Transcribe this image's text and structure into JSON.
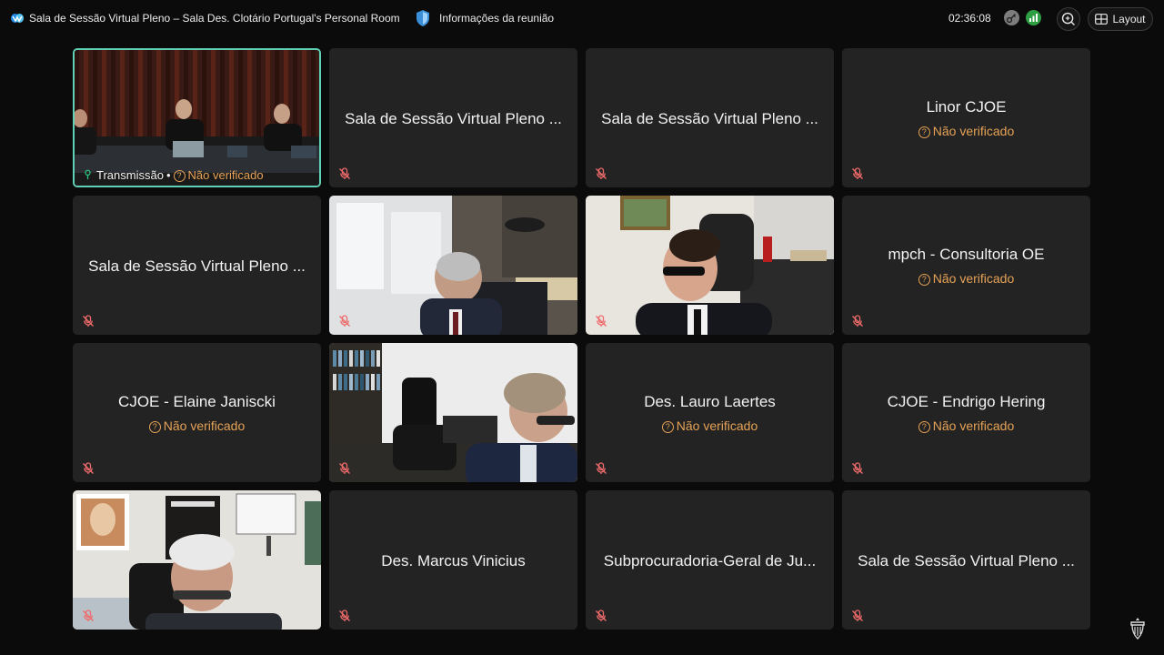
{
  "app": {
    "meeting_title": "Sala de Sessão Virtual Pleno – Sala Des. Clotário Portugal's Personal Room",
    "meeting_info_label": "Informações da reunião",
    "timer": "02:36:08",
    "layout_label": "Layout"
  },
  "tiles": [
    {
      "id": "t1",
      "kind": "video",
      "scene": "courtroom",
      "label": "Transmissão",
      "separator": "•",
      "status": "Não verificado"
    },
    {
      "id": "t2",
      "kind": "name",
      "name": "Sala de Sessão Virtual Pleno ..."
    },
    {
      "id": "t3",
      "kind": "name",
      "name": "Sala de Sessão Virtual Pleno ..."
    },
    {
      "id": "t4",
      "kind": "name",
      "name": "Linor CJOE",
      "status": "Não verificado"
    },
    {
      "id": "t5",
      "kind": "name",
      "name": "Sala de Sessão Virtual Pleno ..."
    },
    {
      "id": "t6",
      "kind": "video",
      "scene": "office-window"
    },
    {
      "id": "t7",
      "kind": "video",
      "scene": "office-glasses"
    },
    {
      "id": "t8",
      "kind": "name",
      "name": "mpch - Consultoria OE",
      "status": "Não verificado"
    },
    {
      "id": "t9",
      "kind": "name",
      "name": "CJOE - Elaine Janiscki",
      "status": "Não verificado"
    },
    {
      "id": "t10",
      "kind": "video",
      "scene": "office-bookshelf"
    },
    {
      "id": "t11",
      "kind": "name",
      "name": "Des. Lauro Laertes",
      "status": "Não verificado"
    },
    {
      "id": "t12",
      "kind": "name",
      "name": "CJOE - Endrigo Hering",
      "status": "Não verificado"
    },
    {
      "id": "t13",
      "kind": "video",
      "scene": "office-poster"
    },
    {
      "id": "t14",
      "kind": "name",
      "name": "Des. Marcus Vinicius"
    },
    {
      "id": "t15",
      "kind": "name",
      "name": "Subprocuradoria-Geral de Ju..."
    },
    {
      "id": "t16",
      "kind": "name",
      "name": "Sala de Sessão Virtual Pleno ..."
    }
  ],
  "colors": {
    "background": "#0b0b0b",
    "tile": "#232323",
    "active_border": "#5fd1b6",
    "status": "#e6a256",
    "mic_muted": "#ef6a6a"
  },
  "icons": {
    "app_logo": "webex-logo-icon",
    "shield": "shield-icon",
    "key": "key-icon",
    "signal": "signal-icon",
    "zoom": "zoom-icon",
    "layout": "layout-grid-icon",
    "mic": "mic-muted-icon",
    "status": "question-circle-icon",
    "footer": "court-seal-icon"
  }
}
